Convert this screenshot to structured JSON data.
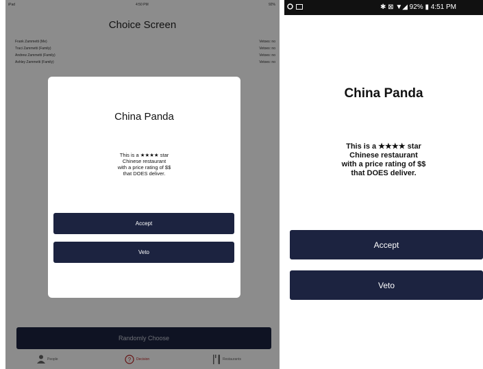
{
  "ipad": {
    "status": {
      "left": "iPad",
      "time": "4:50 PM",
      "battery": "92%"
    },
    "screen_title": "Choice Screen",
    "people": [
      {
        "name": "Frank Zammetti (Me)",
        "status": "Vetoes: no"
      },
      {
        "name": "Traci Zammetti (Family)",
        "status": "Vetoes: no"
      },
      {
        "name": "Andrew Zammetti (Family)",
        "status": "Vetoes: no"
      },
      {
        "name": "Ashley Zammetti (Family)",
        "status": "Vetoes: no"
      }
    ],
    "randomly_choose_label": "Randomly Choose",
    "tabs": [
      {
        "label": "People",
        "icon": "person-icon"
      },
      {
        "label": "Decision",
        "icon": "question-circle-icon"
      },
      {
        "label": "Restaurants",
        "icon": "fork-knife-icon"
      }
    ],
    "modal": {
      "title": "China Panda",
      "desc_line1": "This is a ★★★★ star",
      "desc_line2": "Chinese restaurant",
      "desc_line3": "with a price rating of $$",
      "desc_line4": "that DOES deliver.",
      "accept_label": "Accept",
      "veto_label": "Veto"
    }
  },
  "android": {
    "status_right": "✱ ⊠ ▼◢ 92% ▮ 4:51 PM",
    "title": "China Panda",
    "desc_line1": "This is a ★★★★ star",
    "desc_line2": "Chinese restaurant",
    "desc_line3": "with a price rating of $$",
    "desc_line4": "that DOES deliver.",
    "accept_label": "Accept",
    "veto_label": "Veto"
  },
  "colors": {
    "button": "#1c2340",
    "dim_overlay": "rgba(0,0,0,0.45)",
    "active_tab": "#b22222"
  }
}
